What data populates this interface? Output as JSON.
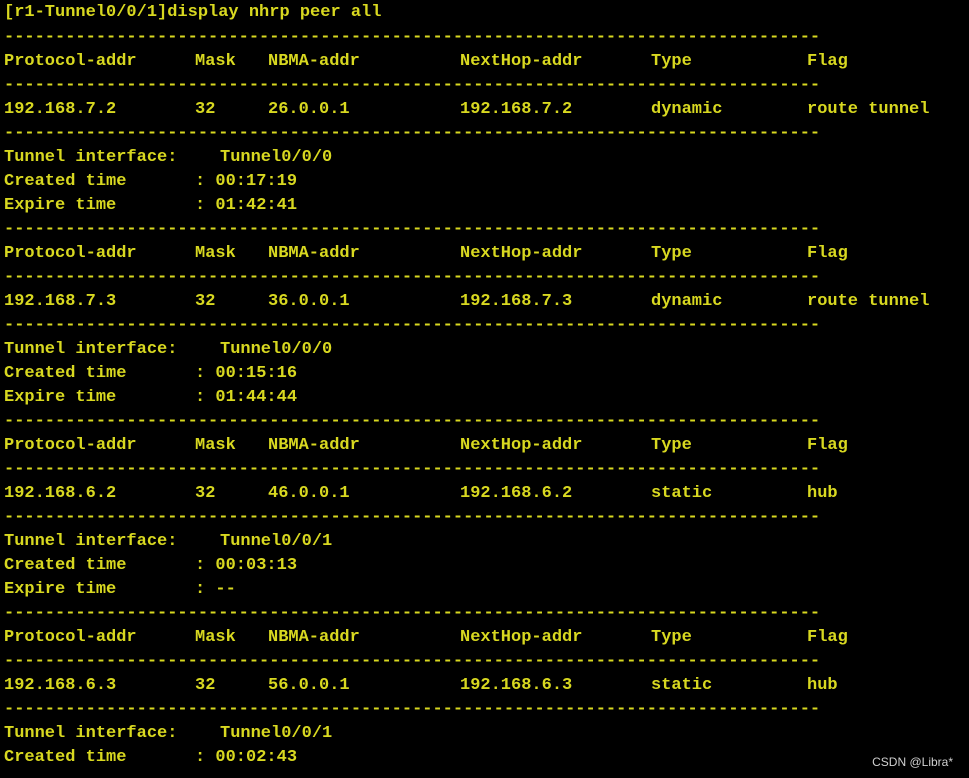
{
  "terminal": {
    "prompt_command": "[r1-Tunnel0/0/1]display nhrp peer all",
    "separator": "--------------------------------------------------------------------------------",
    "headers": [
      "Protocol-addr",
      "Mask",
      "NBMA-addr",
      "NextHop-addr",
      "Type",
      "Flag"
    ],
    "peers": [
      {
        "protocol_addr": "192.168.7.2",
        "mask": "32",
        "nbma_addr": "26.0.0.1",
        "nexthop_addr": "192.168.7.2",
        "type": "dynamic",
        "flag": "route tunnel",
        "tunnel_label": "Tunnel interface:",
        "tunnel_value": "Tunnel0/0/0",
        "created_label": "Created time",
        "created_value": ": 00:17:19",
        "expire_label": "Expire time",
        "expire_value": ": 01:42:41"
      },
      {
        "protocol_addr": "192.168.7.3",
        "mask": "32",
        "nbma_addr": "36.0.0.1",
        "nexthop_addr": "192.168.7.3",
        "type": "dynamic",
        "flag": "route tunnel",
        "tunnel_label": "Tunnel interface:",
        "tunnel_value": "Tunnel0/0/0",
        "created_label": "Created time",
        "created_value": ": 00:15:16",
        "expire_label": "Expire time",
        "expire_value": ": 01:44:44"
      },
      {
        "protocol_addr": "192.168.6.2",
        "mask": "32",
        "nbma_addr": "46.0.0.1",
        "nexthop_addr": "192.168.6.2",
        "type": "static",
        "flag": "hub",
        "tunnel_label": "Tunnel interface:",
        "tunnel_value": "Tunnel0/0/1",
        "created_label": "Created time",
        "created_value": ": 00:03:13",
        "expire_label": "Expire time",
        "expire_value": ": --"
      },
      {
        "protocol_addr": "192.168.6.3",
        "mask": "32",
        "nbma_addr": "56.0.0.1",
        "nexthop_addr": "192.168.6.3",
        "type": "static",
        "flag": "hub",
        "tunnel_label": "Tunnel interface:",
        "tunnel_value": "Tunnel0/0/1",
        "created_label": "Created time",
        "created_value": ": 00:02:43"
      }
    ],
    "text_color": "#d8d820",
    "background_color": "#000000"
  },
  "watermark": "CSDN @Libra*"
}
